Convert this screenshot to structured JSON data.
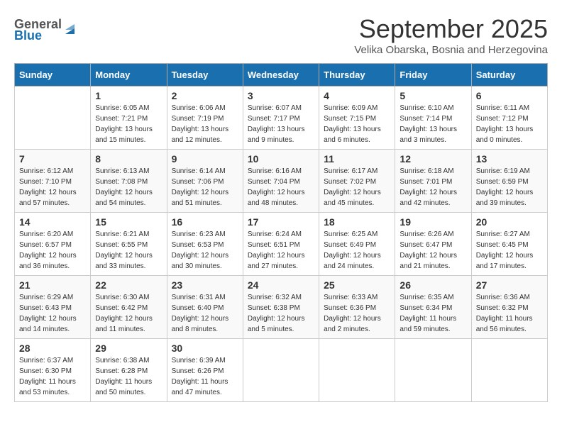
{
  "header": {
    "logo_line1": "General",
    "logo_line2": "Blue",
    "month": "September 2025",
    "location": "Velika Obarska, Bosnia and Herzegovina"
  },
  "days_of_week": [
    "Sunday",
    "Monday",
    "Tuesday",
    "Wednesday",
    "Thursday",
    "Friday",
    "Saturday"
  ],
  "weeks": [
    [
      {
        "day": "",
        "sunrise": "",
        "sunset": "",
        "daylight": ""
      },
      {
        "day": "1",
        "sunrise": "Sunrise: 6:05 AM",
        "sunset": "Sunset: 7:21 PM",
        "daylight": "Daylight: 13 hours and 15 minutes."
      },
      {
        "day": "2",
        "sunrise": "Sunrise: 6:06 AM",
        "sunset": "Sunset: 7:19 PM",
        "daylight": "Daylight: 13 hours and 12 minutes."
      },
      {
        "day": "3",
        "sunrise": "Sunrise: 6:07 AM",
        "sunset": "Sunset: 7:17 PM",
        "daylight": "Daylight: 13 hours and 9 minutes."
      },
      {
        "day": "4",
        "sunrise": "Sunrise: 6:09 AM",
        "sunset": "Sunset: 7:15 PM",
        "daylight": "Daylight: 13 hours and 6 minutes."
      },
      {
        "day": "5",
        "sunrise": "Sunrise: 6:10 AM",
        "sunset": "Sunset: 7:14 PM",
        "daylight": "Daylight: 13 hours and 3 minutes."
      },
      {
        "day": "6",
        "sunrise": "Sunrise: 6:11 AM",
        "sunset": "Sunset: 7:12 PM",
        "daylight": "Daylight: 13 hours and 0 minutes."
      }
    ],
    [
      {
        "day": "7",
        "sunrise": "Sunrise: 6:12 AM",
        "sunset": "Sunset: 7:10 PM",
        "daylight": "Daylight: 12 hours and 57 minutes."
      },
      {
        "day": "8",
        "sunrise": "Sunrise: 6:13 AM",
        "sunset": "Sunset: 7:08 PM",
        "daylight": "Daylight: 12 hours and 54 minutes."
      },
      {
        "day": "9",
        "sunrise": "Sunrise: 6:14 AM",
        "sunset": "Sunset: 7:06 PM",
        "daylight": "Daylight: 12 hours and 51 minutes."
      },
      {
        "day": "10",
        "sunrise": "Sunrise: 6:16 AM",
        "sunset": "Sunset: 7:04 PM",
        "daylight": "Daylight: 12 hours and 48 minutes."
      },
      {
        "day": "11",
        "sunrise": "Sunrise: 6:17 AM",
        "sunset": "Sunset: 7:02 PM",
        "daylight": "Daylight: 12 hours and 45 minutes."
      },
      {
        "day": "12",
        "sunrise": "Sunrise: 6:18 AM",
        "sunset": "Sunset: 7:01 PM",
        "daylight": "Daylight: 12 hours and 42 minutes."
      },
      {
        "day": "13",
        "sunrise": "Sunrise: 6:19 AM",
        "sunset": "Sunset: 6:59 PM",
        "daylight": "Daylight: 12 hours and 39 minutes."
      }
    ],
    [
      {
        "day": "14",
        "sunrise": "Sunrise: 6:20 AM",
        "sunset": "Sunset: 6:57 PM",
        "daylight": "Daylight: 12 hours and 36 minutes."
      },
      {
        "day": "15",
        "sunrise": "Sunrise: 6:21 AM",
        "sunset": "Sunset: 6:55 PM",
        "daylight": "Daylight: 12 hours and 33 minutes."
      },
      {
        "day": "16",
        "sunrise": "Sunrise: 6:23 AM",
        "sunset": "Sunset: 6:53 PM",
        "daylight": "Daylight: 12 hours and 30 minutes."
      },
      {
        "day": "17",
        "sunrise": "Sunrise: 6:24 AM",
        "sunset": "Sunset: 6:51 PM",
        "daylight": "Daylight: 12 hours and 27 minutes."
      },
      {
        "day": "18",
        "sunrise": "Sunrise: 6:25 AM",
        "sunset": "Sunset: 6:49 PM",
        "daylight": "Daylight: 12 hours and 24 minutes."
      },
      {
        "day": "19",
        "sunrise": "Sunrise: 6:26 AM",
        "sunset": "Sunset: 6:47 PM",
        "daylight": "Daylight: 12 hours and 21 minutes."
      },
      {
        "day": "20",
        "sunrise": "Sunrise: 6:27 AM",
        "sunset": "Sunset: 6:45 PM",
        "daylight": "Daylight: 12 hours and 17 minutes."
      }
    ],
    [
      {
        "day": "21",
        "sunrise": "Sunrise: 6:29 AM",
        "sunset": "Sunset: 6:43 PM",
        "daylight": "Daylight: 12 hours and 14 minutes."
      },
      {
        "day": "22",
        "sunrise": "Sunrise: 6:30 AM",
        "sunset": "Sunset: 6:42 PM",
        "daylight": "Daylight: 12 hours and 11 minutes."
      },
      {
        "day": "23",
        "sunrise": "Sunrise: 6:31 AM",
        "sunset": "Sunset: 6:40 PM",
        "daylight": "Daylight: 12 hours and 8 minutes."
      },
      {
        "day": "24",
        "sunrise": "Sunrise: 6:32 AM",
        "sunset": "Sunset: 6:38 PM",
        "daylight": "Daylight: 12 hours and 5 minutes."
      },
      {
        "day": "25",
        "sunrise": "Sunrise: 6:33 AM",
        "sunset": "Sunset: 6:36 PM",
        "daylight": "Daylight: 12 hours and 2 minutes."
      },
      {
        "day": "26",
        "sunrise": "Sunrise: 6:35 AM",
        "sunset": "Sunset: 6:34 PM",
        "daylight": "Daylight: 11 hours and 59 minutes."
      },
      {
        "day": "27",
        "sunrise": "Sunrise: 6:36 AM",
        "sunset": "Sunset: 6:32 PM",
        "daylight": "Daylight: 11 hours and 56 minutes."
      }
    ],
    [
      {
        "day": "28",
        "sunrise": "Sunrise: 6:37 AM",
        "sunset": "Sunset: 6:30 PM",
        "daylight": "Daylight: 11 hours and 53 minutes."
      },
      {
        "day": "29",
        "sunrise": "Sunrise: 6:38 AM",
        "sunset": "Sunset: 6:28 PM",
        "daylight": "Daylight: 11 hours and 50 minutes."
      },
      {
        "day": "30",
        "sunrise": "Sunrise: 6:39 AM",
        "sunset": "Sunset: 6:26 PM",
        "daylight": "Daylight: 11 hours and 47 minutes."
      },
      {
        "day": "",
        "sunrise": "",
        "sunset": "",
        "daylight": ""
      },
      {
        "day": "",
        "sunrise": "",
        "sunset": "",
        "daylight": ""
      },
      {
        "day": "",
        "sunrise": "",
        "sunset": "",
        "daylight": ""
      },
      {
        "day": "",
        "sunrise": "",
        "sunset": "",
        "daylight": ""
      }
    ]
  ]
}
